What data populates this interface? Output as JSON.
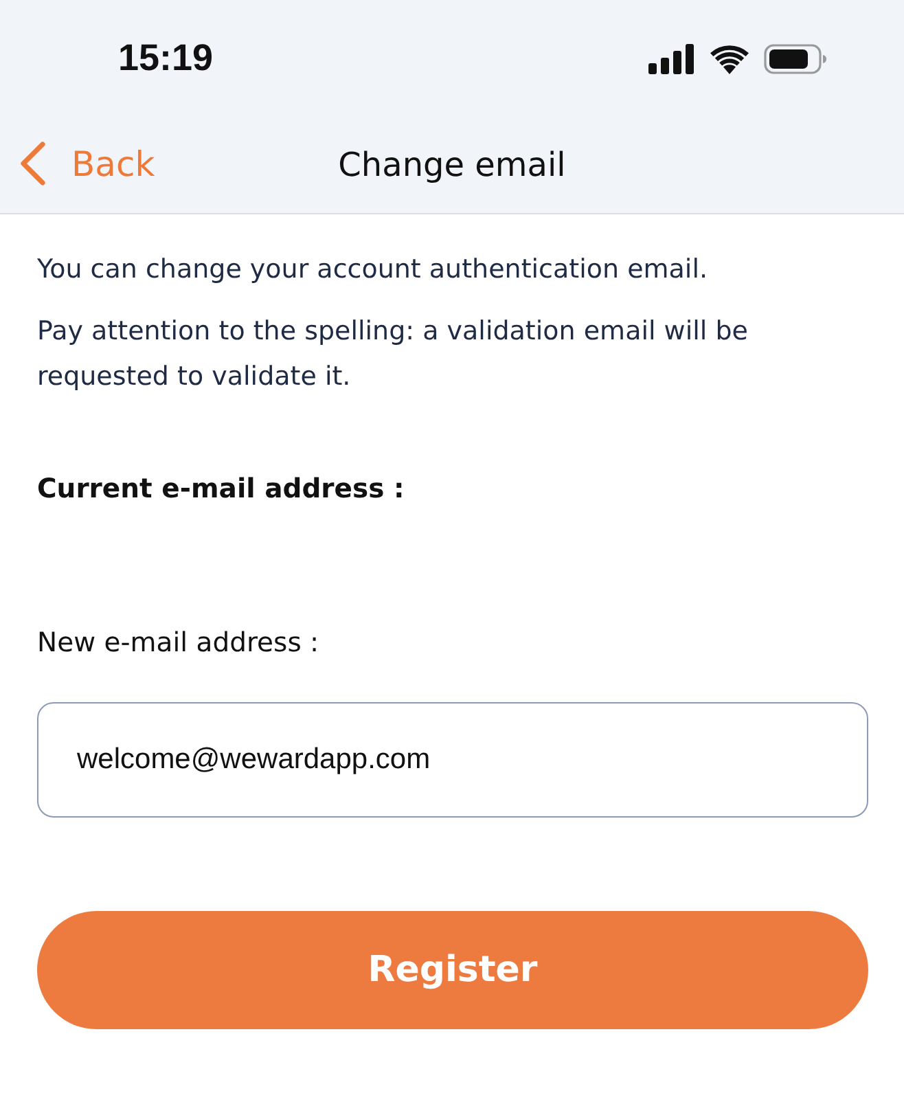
{
  "status_bar": {
    "time": "15:19"
  },
  "nav_bar": {
    "back_label": "Back",
    "title": "Change email"
  },
  "intro": [
    "You can change your account authentication email.",
    "Pay attention to the spelling: a validation email will be requested to validate it."
  ],
  "current_email": {
    "label": "Current e-mail address :"
  },
  "new_email": {
    "label": "New e-mail address :",
    "value": "welcome@wewardapp.com"
  },
  "button": {
    "label": "Register"
  }
}
